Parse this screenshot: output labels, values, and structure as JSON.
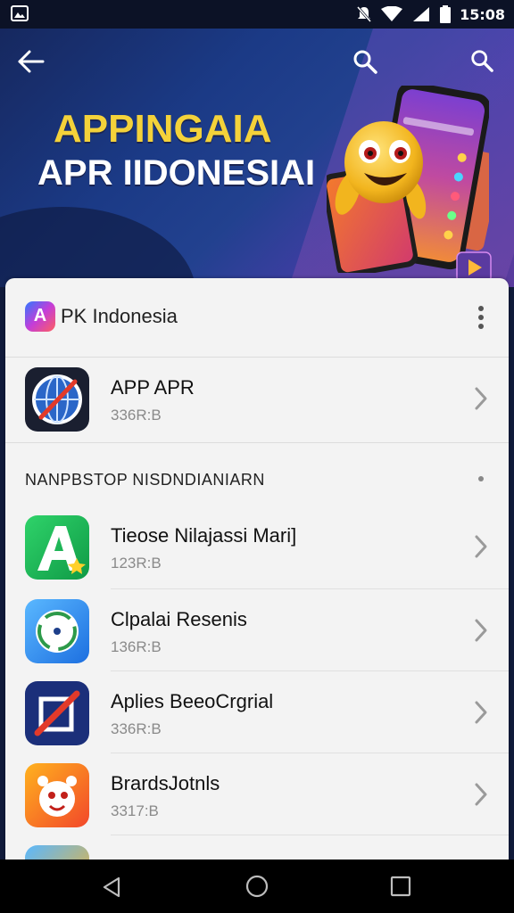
{
  "status_bar": {
    "time": "15:08",
    "icons": [
      "gallery-icon",
      "mute-icon",
      "wifi-icon",
      "signal-icon",
      "battery-icon"
    ]
  },
  "banner": {
    "title_line1": "APPINGAIA",
    "title_line2": "APR IIDONESIAI",
    "icons": [
      "back-arrow-icon",
      "search-icon",
      "search-icon",
      "play-icon"
    ],
    "colors": {
      "title_yellow": "#f4d23a",
      "background": "#1b3a86"
    }
  },
  "card_header": {
    "logo_letter": "A",
    "name": "PK Indonesia",
    "menu_icon": "more-vertical-icon"
  },
  "featured": {
    "title": "APP APR",
    "size": "336R:B",
    "icon": "globe-compass-icon"
  },
  "section": {
    "title": "NANPBSTOP NISDNDIANIARN"
  },
  "apps": [
    {
      "title": "Tieose Nilajassi Mari]",
      "size": "123R:B",
      "icon": "green-a-icon"
    },
    {
      "title": "Clpalai Resenis",
      "size": "136R:B",
      "icon": "compass-icon"
    },
    {
      "title": "Aplies BeeoCrgrial",
      "size": "336R:B",
      "icon": "red-slash-icon"
    },
    {
      "title": "BrardsJotnls",
      "size": "3317:B",
      "icon": "cartoon-face-icon"
    }
  ],
  "nav_bar": {
    "icons": [
      "nav-back-icon",
      "nav-home-icon",
      "nav-recents-icon"
    ]
  }
}
